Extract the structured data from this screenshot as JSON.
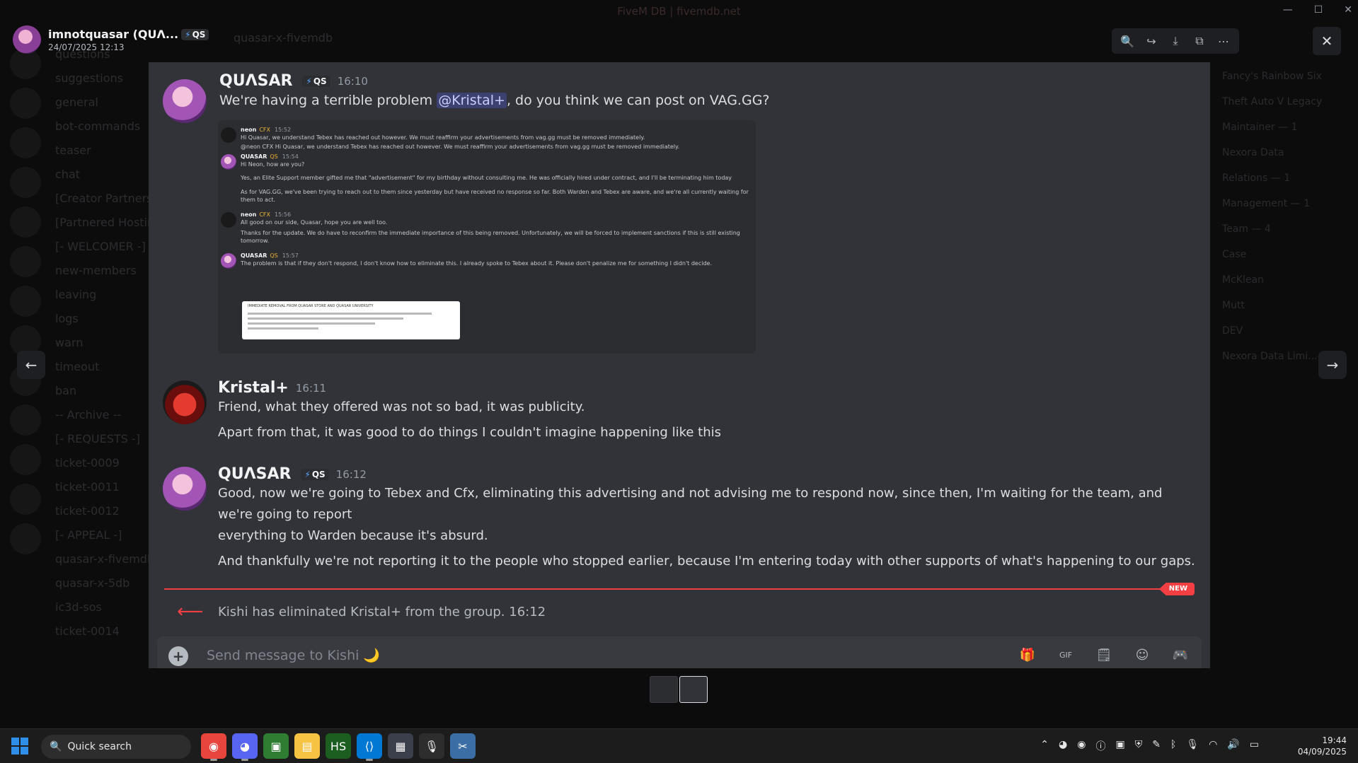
{
  "window_title": "FiveM DB | fivemdb.net",
  "bg": {
    "channel_header": "quasar-x-fivemdb",
    "channels": [
      "questions",
      "suggestions",
      "general",
      "bot-commands",
      "teaser",
      "chat",
      "[Creator Partners]",
      "[Partnered Hosting]",
      "[- WELCOMER -]",
      "new-members",
      "leaving",
      "logs",
      "warn",
      "timeout",
      "ban",
      "-- Archive --",
      "[- REQUESTS -]",
      "ticket-0009",
      "ticket-0011",
      "ticket-0012",
      "[- APPEAL -]",
      "quasar-x-fivemdb",
      "quasar-x-5db",
      "ic3d-sos",
      "ticket-0014"
    ],
    "members": [
      "Fancy's Rainbow Six",
      "Theft Auto V Legacy",
      "Maintainer — 1",
      "Nexora Data",
      "Relations — 1",
      "Management — 1",
      "Team — 4",
      "Case",
      "McKlean",
      "Mutt",
      "DEV",
      "Nexora Data Limi..."
    ]
  },
  "viewer": {
    "user_name": "imnotquasar (QUΛ...",
    "user_tag": "QS",
    "date": "24/07/2025 12:13",
    "tools": [
      {
        "name": "zoom-icon",
        "glyph": "🔍"
      },
      {
        "name": "forward-icon",
        "glyph": "↪"
      },
      {
        "name": "download-icon",
        "glyph": "⤓"
      },
      {
        "name": "open-external-icon",
        "glyph": "⧉"
      },
      {
        "name": "more-icon",
        "glyph": "⋯"
      }
    ],
    "close_glyph": "✕",
    "prev_glyph": "←",
    "next_glyph": "→"
  },
  "messages": [
    {
      "author": "QUΛSAR",
      "tag": "QS",
      "time": "16:10",
      "lines": [
        "We're having a terrible problem @Kristal+, do you think we can post on VAG.GG?"
      ]
    },
    {
      "author": "Kristal+",
      "time": "16:11",
      "lines": [
        "Friend, what they offered was not so bad, it was publicity.",
        "Apart from that, it was good to do things I couldn't imagine happening like this"
      ]
    },
    {
      "author": "QUΛSAR",
      "tag": "QS",
      "time": "16:12",
      "lines": [
        "Good, now we're going to Tebex and Cfx, eliminating this advertising and not advising me to respond now, since then, I'm waiting for the team, and we're going to report",
        "everything to Warden because it's absurd.",
        "And thankfully we're not reporting it to the people who stopped earlier, because I'm entering today with other supports of what's happening to our gaps."
      ]
    }
  ],
  "embed": {
    "rows": [
      {
        "name": "neon",
        "tag": "CFX",
        "time": "15:52",
        "text": "Hi Quasar, we understand Tebex has reached out however. We must reaffirm your advertisements from vag.gg must be removed immediately."
      },
      {
        "name": "",
        "tag": "",
        "time": "",
        "text": "@neon CFX Hi Quasar, we understand Tebex has reached out however. We must reaffirm your advertisements from vag.gg must be removed immediately."
      },
      {
        "name": "QUASAR",
        "tag": "QS",
        "time": "15:54",
        "text": "Hi Neon, how are you?"
      },
      {
        "name": "",
        "tag": "",
        "time": "",
        "text": "Yes, an Elite Support member gifted me that \"advertisement\" for my birthday without consulting me. He was officially hired under contract, and I'll be terminating him today"
      },
      {
        "name": "",
        "tag": "",
        "time": "",
        "text": "As for VAG.GG, we've been trying to reach out to them since yesterday but have received no response so far. Both Warden and Tebex are aware, and we're all currently waiting for them to act."
      },
      {
        "name": "neon",
        "tag": "CFX",
        "time": "15:56",
        "text": "All good on our side, Quasar, hope you are well too."
      },
      {
        "name": "",
        "tag": "",
        "time": "",
        "text": "Thanks for the update. We do have to reconfirm the immediate importance of this being removed. Unfortunately, we will be forced to implement sanctions if this is still existing tomorrow."
      },
      {
        "name": "QUASAR",
        "tag": "QS",
        "time": "15:57",
        "text": "The problem is that if they don't respond, I don't know how to eliminate this. I already spoke to Tebex about it. Please don't penalize me for something I didn't decide."
      }
    ],
    "image_title": "IMMEDIATE REMOVAL FROM QUASAR STORE AND QUASAR UNIVERSITY"
  },
  "new_badge": "NEW",
  "system_message": "Kishi has eliminated Kristal+ from the group. 16:12",
  "composer": {
    "placeholder": "Send message to Kishi 🌙",
    "icons": [
      {
        "name": "gift-icon",
        "glyph": "🎁"
      },
      {
        "name": "gif-icon",
        "glyph": "GIF"
      },
      {
        "name": "sticker-icon",
        "glyph": "🗒"
      },
      {
        "name": "emoji-icon",
        "glyph": "☺"
      },
      {
        "name": "apps-icon",
        "glyph": "🎮"
      }
    ]
  },
  "taskbar": {
    "search_label": "Quick search",
    "time": "19:44",
    "date": "04/09/2025",
    "apps": [
      {
        "name": "chrome-app",
        "glyph": "◉",
        "color": "#e8453c"
      },
      {
        "name": "discord-app",
        "glyph": "◕",
        "color": "#5865f2"
      },
      {
        "name": "photos-app",
        "glyph": "▣",
        "color": "#2e7d32"
      },
      {
        "name": "explorer-app",
        "glyph": "▤",
        "color": "#f6c343"
      },
      {
        "name": "hs-app",
        "glyph": "HS",
        "color": "#1b5e20"
      },
      {
        "name": "vscode-app",
        "glyph": "⟨⟩",
        "color": "#0078d4"
      },
      {
        "name": "tool-app",
        "glyph": "▦",
        "color": "#3a3f4b"
      },
      {
        "name": "mic-app",
        "glyph": "🎙",
        "color": "#2d2d2d"
      },
      {
        "name": "snip-app",
        "glyph": "✂",
        "color": "#3a6ea5"
      }
    ]
  }
}
